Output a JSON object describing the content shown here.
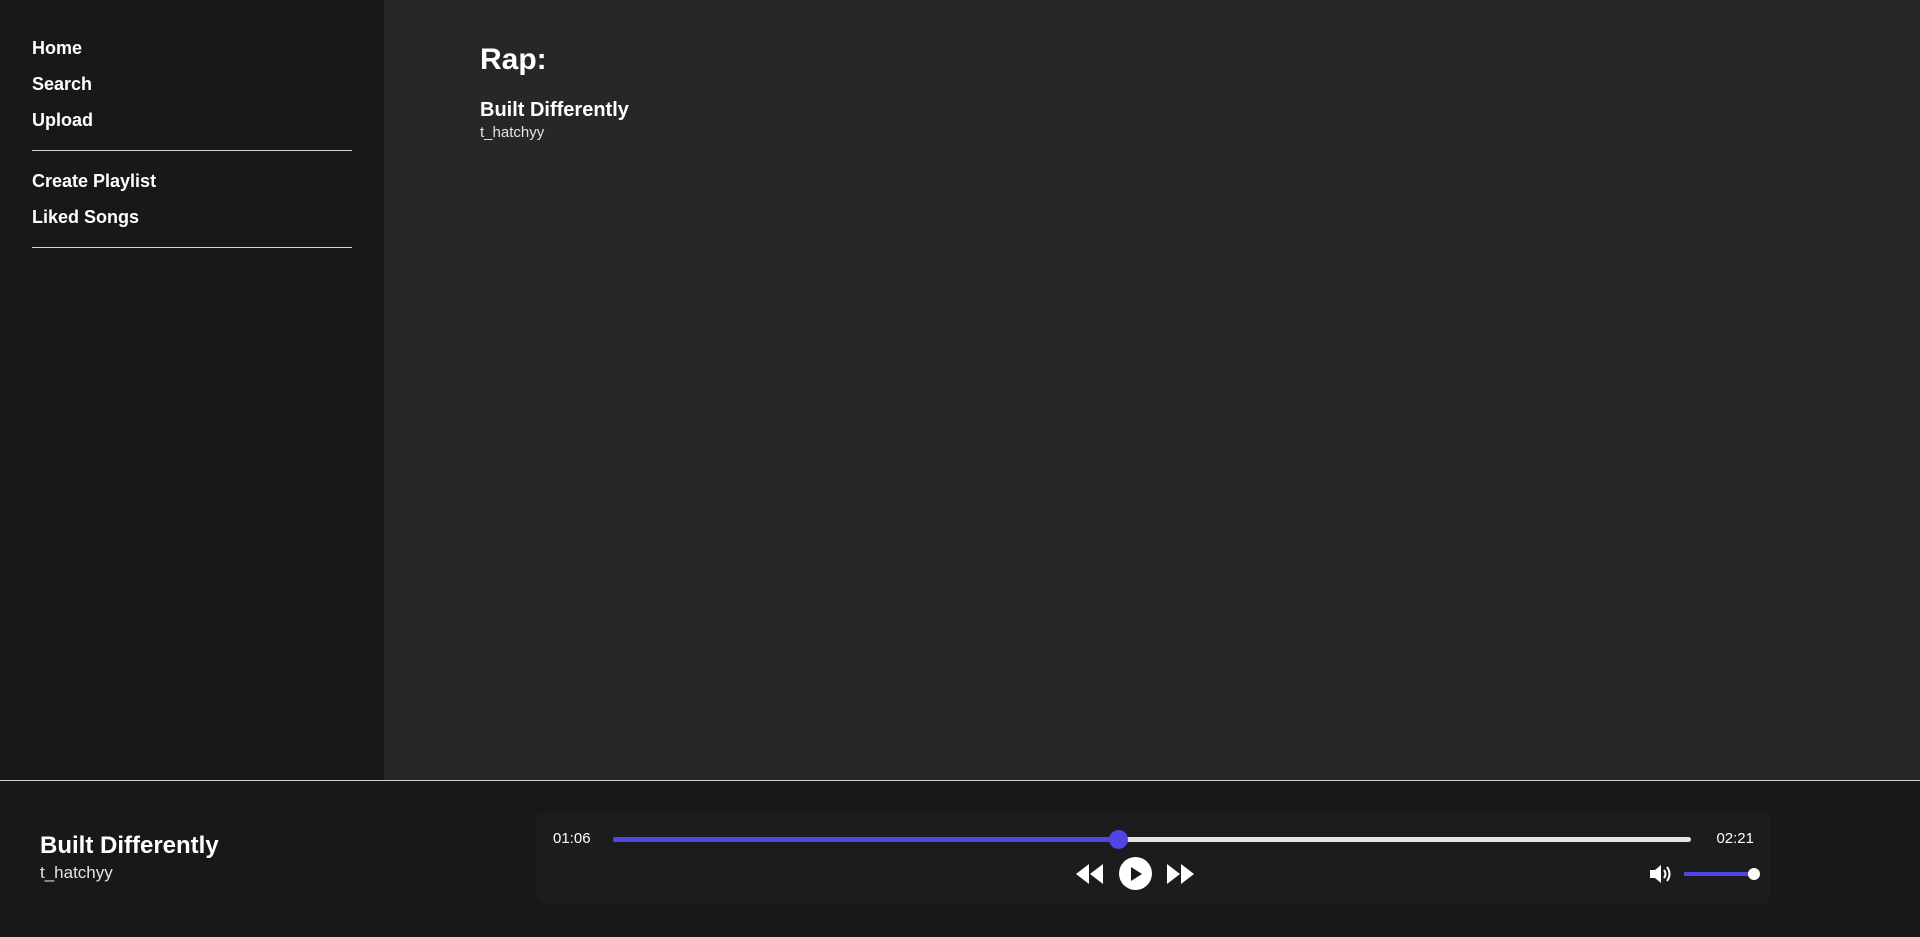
{
  "sidebar": {
    "nav_primary": [
      {
        "label": "Home"
      },
      {
        "label": "Search"
      },
      {
        "label": "Upload"
      }
    ],
    "nav_secondary": [
      {
        "label": "Create Playlist"
      },
      {
        "label": "Liked Songs"
      }
    ]
  },
  "main": {
    "genre_title": "Rap:",
    "songs": [
      {
        "title": "Built Differently",
        "artist": "t_hatchyy"
      }
    ]
  },
  "player": {
    "now_playing": {
      "title": "Built Differently",
      "artist": "t_hatchyy"
    },
    "current_time": "01:06",
    "total_time": "02:21",
    "progress_fraction": 0.468,
    "volume_fraction": 1.0,
    "icons": {
      "rewind": "rewind-icon",
      "play": "play-icon",
      "forward": "fast-forward-icon",
      "volume": "volume-icon"
    }
  },
  "colors": {
    "accent": "#4f46e5",
    "sidebar_bg": "#18181b",
    "main_bg": "#27272a",
    "text": "#ffffff"
  }
}
